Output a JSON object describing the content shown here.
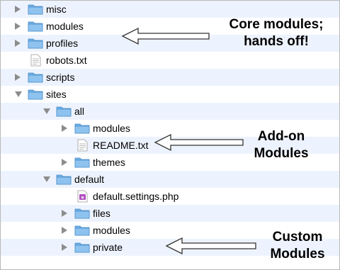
{
  "tree": [
    {
      "label": "misc",
      "type": "folder",
      "toggle": "closed",
      "depth": 0
    },
    {
      "label": "modules",
      "type": "folder",
      "toggle": "closed",
      "depth": 0
    },
    {
      "label": "profiles",
      "type": "folder",
      "toggle": "closed",
      "depth": 0
    },
    {
      "label": "robots.txt",
      "type": "text-file",
      "toggle": "none",
      "depth": 0
    },
    {
      "label": "scripts",
      "type": "folder",
      "toggle": "closed",
      "depth": 0
    },
    {
      "label": "sites",
      "type": "folder",
      "toggle": "open",
      "depth": 0
    },
    {
      "label": "all",
      "type": "folder",
      "toggle": "open",
      "depth": 1
    },
    {
      "label": "modules",
      "type": "folder",
      "toggle": "closed",
      "depth": 2
    },
    {
      "label": "README.txt",
      "type": "text-file",
      "toggle": "none",
      "depth": 2
    },
    {
      "label": "themes",
      "type": "folder",
      "toggle": "closed",
      "depth": 2
    },
    {
      "label": "default",
      "type": "folder",
      "toggle": "open",
      "depth": 1
    },
    {
      "label": "default.settings.php",
      "type": "php-file",
      "toggle": "none",
      "depth": 2
    },
    {
      "label": "files",
      "type": "folder",
      "toggle": "closed",
      "depth": 2
    },
    {
      "label": "modules",
      "type": "folder",
      "toggle": "closed",
      "depth": 2
    },
    {
      "label": "private",
      "type": "folder",
      "toggle": "closed",
      "depth": 2
    }
  ],
  "annotations": {
    "core": {
      "line1": "Core modules;",
      "line2": "hands off!"
    },
    "addon": {
      "line1": "Add-on",
      "line2": "Modules"
    },
    "custom": {
      "line1": "Custom",
      "line2": "Modules"
    }
  },
  "colors": {
    "folder_body": "#8fc3ef",
    "folder_tab": "#6eaee6",
    "folder_outline": "#4d8fc9",
    "row_stripe": "#edf3fe",
    "disclosure": "#8c8c8c",
    "arrow_stroke": "#333333"
  }
}
